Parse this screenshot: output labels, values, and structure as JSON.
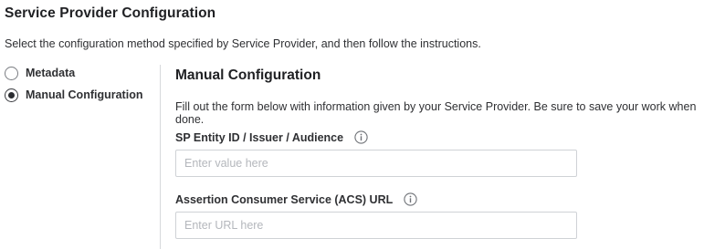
{
  "page": {
    "title": "Service Provider Configuration",
    "instructions": "Select the configuration method specified by Service Provider, and then follow the instructions."
  },
  "method": {
    "options": [
      {
        "label": "Metadata",
        "selected": false
      },
      {
        "label": "Manual Configuration",
        "selected": true
      }
    ]
  },
  "manual": {
    "title": "Manual Configuration",
    "description": "Fill out the form below with information given by your Service Provider. Be sure to save your work when done.",
    "entity_id": {
      "label": "SP Entity ID / Issuer / Audience",
      "value": "",
      "placeholder": "Enter value here"
    },
    "acs_url": {
      "label": "Assertion Consumer Service (ACS) URL",
      "value": "",
      "placeholder": "Enter URL here"
    }
  },
  "icons": {
    "info": "info-circle-icon",
    "radio_selected": "radio-selected-icon",
    "radio_unselected": "radio-unselected-icon"
  },
  "colors": {
    "text_primary": "#2f3033",
    "input_border": "#cfd2d6",
    "placeholder": "#b4b7bc",
    "divider": "#d7d9dc"
  }
}
